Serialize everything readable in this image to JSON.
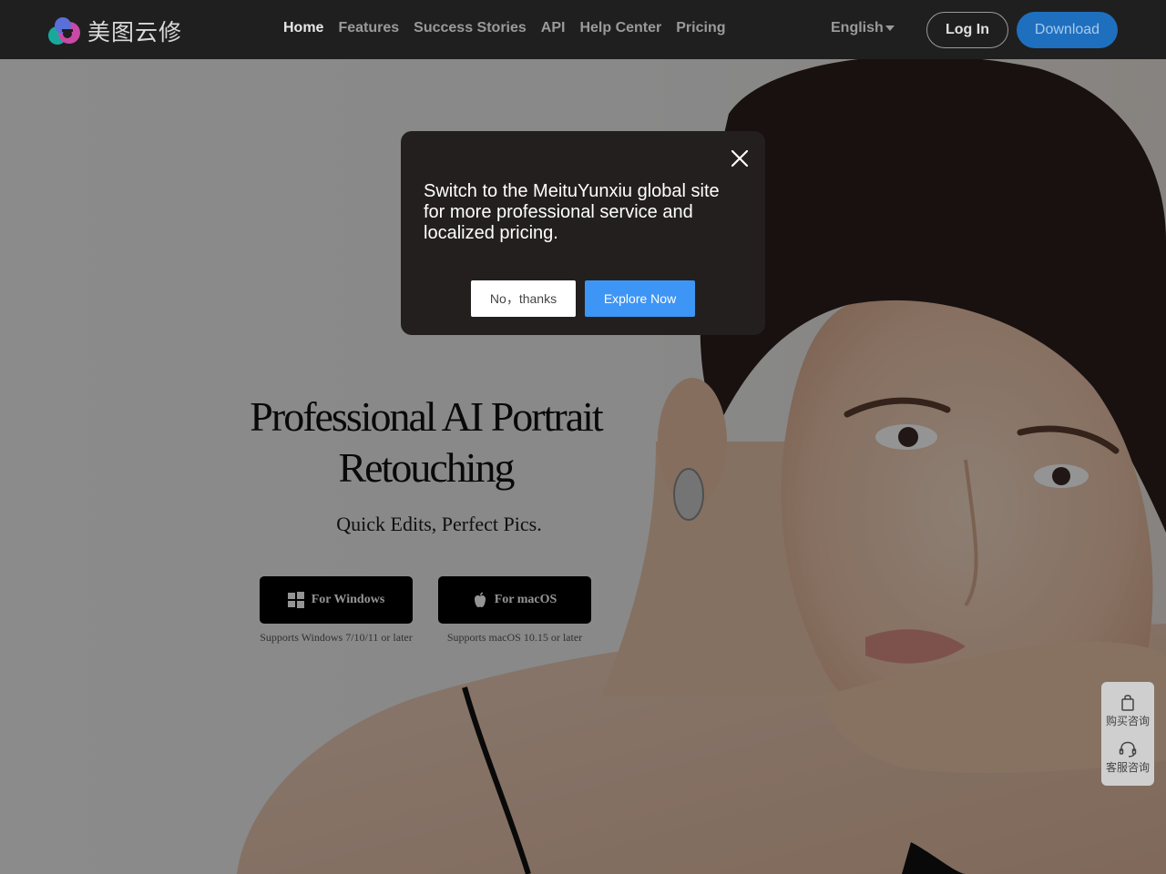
{
  "brand": {
    "name": "美图云修"
  },
  "nav": {
    "links": [
      {
        "label": "Home"
      },
      {
        "label": "Features"
      },
      {
        "label": "Success Stories"
      },
      {
        "label": "API"
      },
      {
        "label": "Help Center"
      },
      {
        "label": "Pricing"
      }
    ],
    "language": "English",
    "login_label": "Log In",
    "download_label": "Download"
  },
  "hero": {
    "title": "Professional AI Portrait Retouching",
    "subtitle": "Quick Edits, Perfect Pics.",
    "windows_button": "For Windows",
    "mac_button": "For macOS",
    "windows_requirement": "Supports Windows 7/10/11 or later",
    "mac_requirement": "Supports macOS 10.15 or later"
  },
  "side_widget": {
    "items": [
      {
        "label": "购买咨询",
        "icon": "shopping-bag-icon"
      },
      {
        "label": "客服咨询",
        "icon": "headset-icon"
      }
    ]
  },
  "modal": {
    "message": "Switch to the MeituYunxiu global site for more professional service and localized pricing.",
    "dismiss_label": "No，thanks",
    "confirm_label": "Explore Now"
  },
  "colors": {
    "nav_bg": "#1f1f1f",
    "download_btn": "#1f6fbf",
    "explore_btn": "#3d95f5",
    "modal_bg": "#231f1e"
  }
}
